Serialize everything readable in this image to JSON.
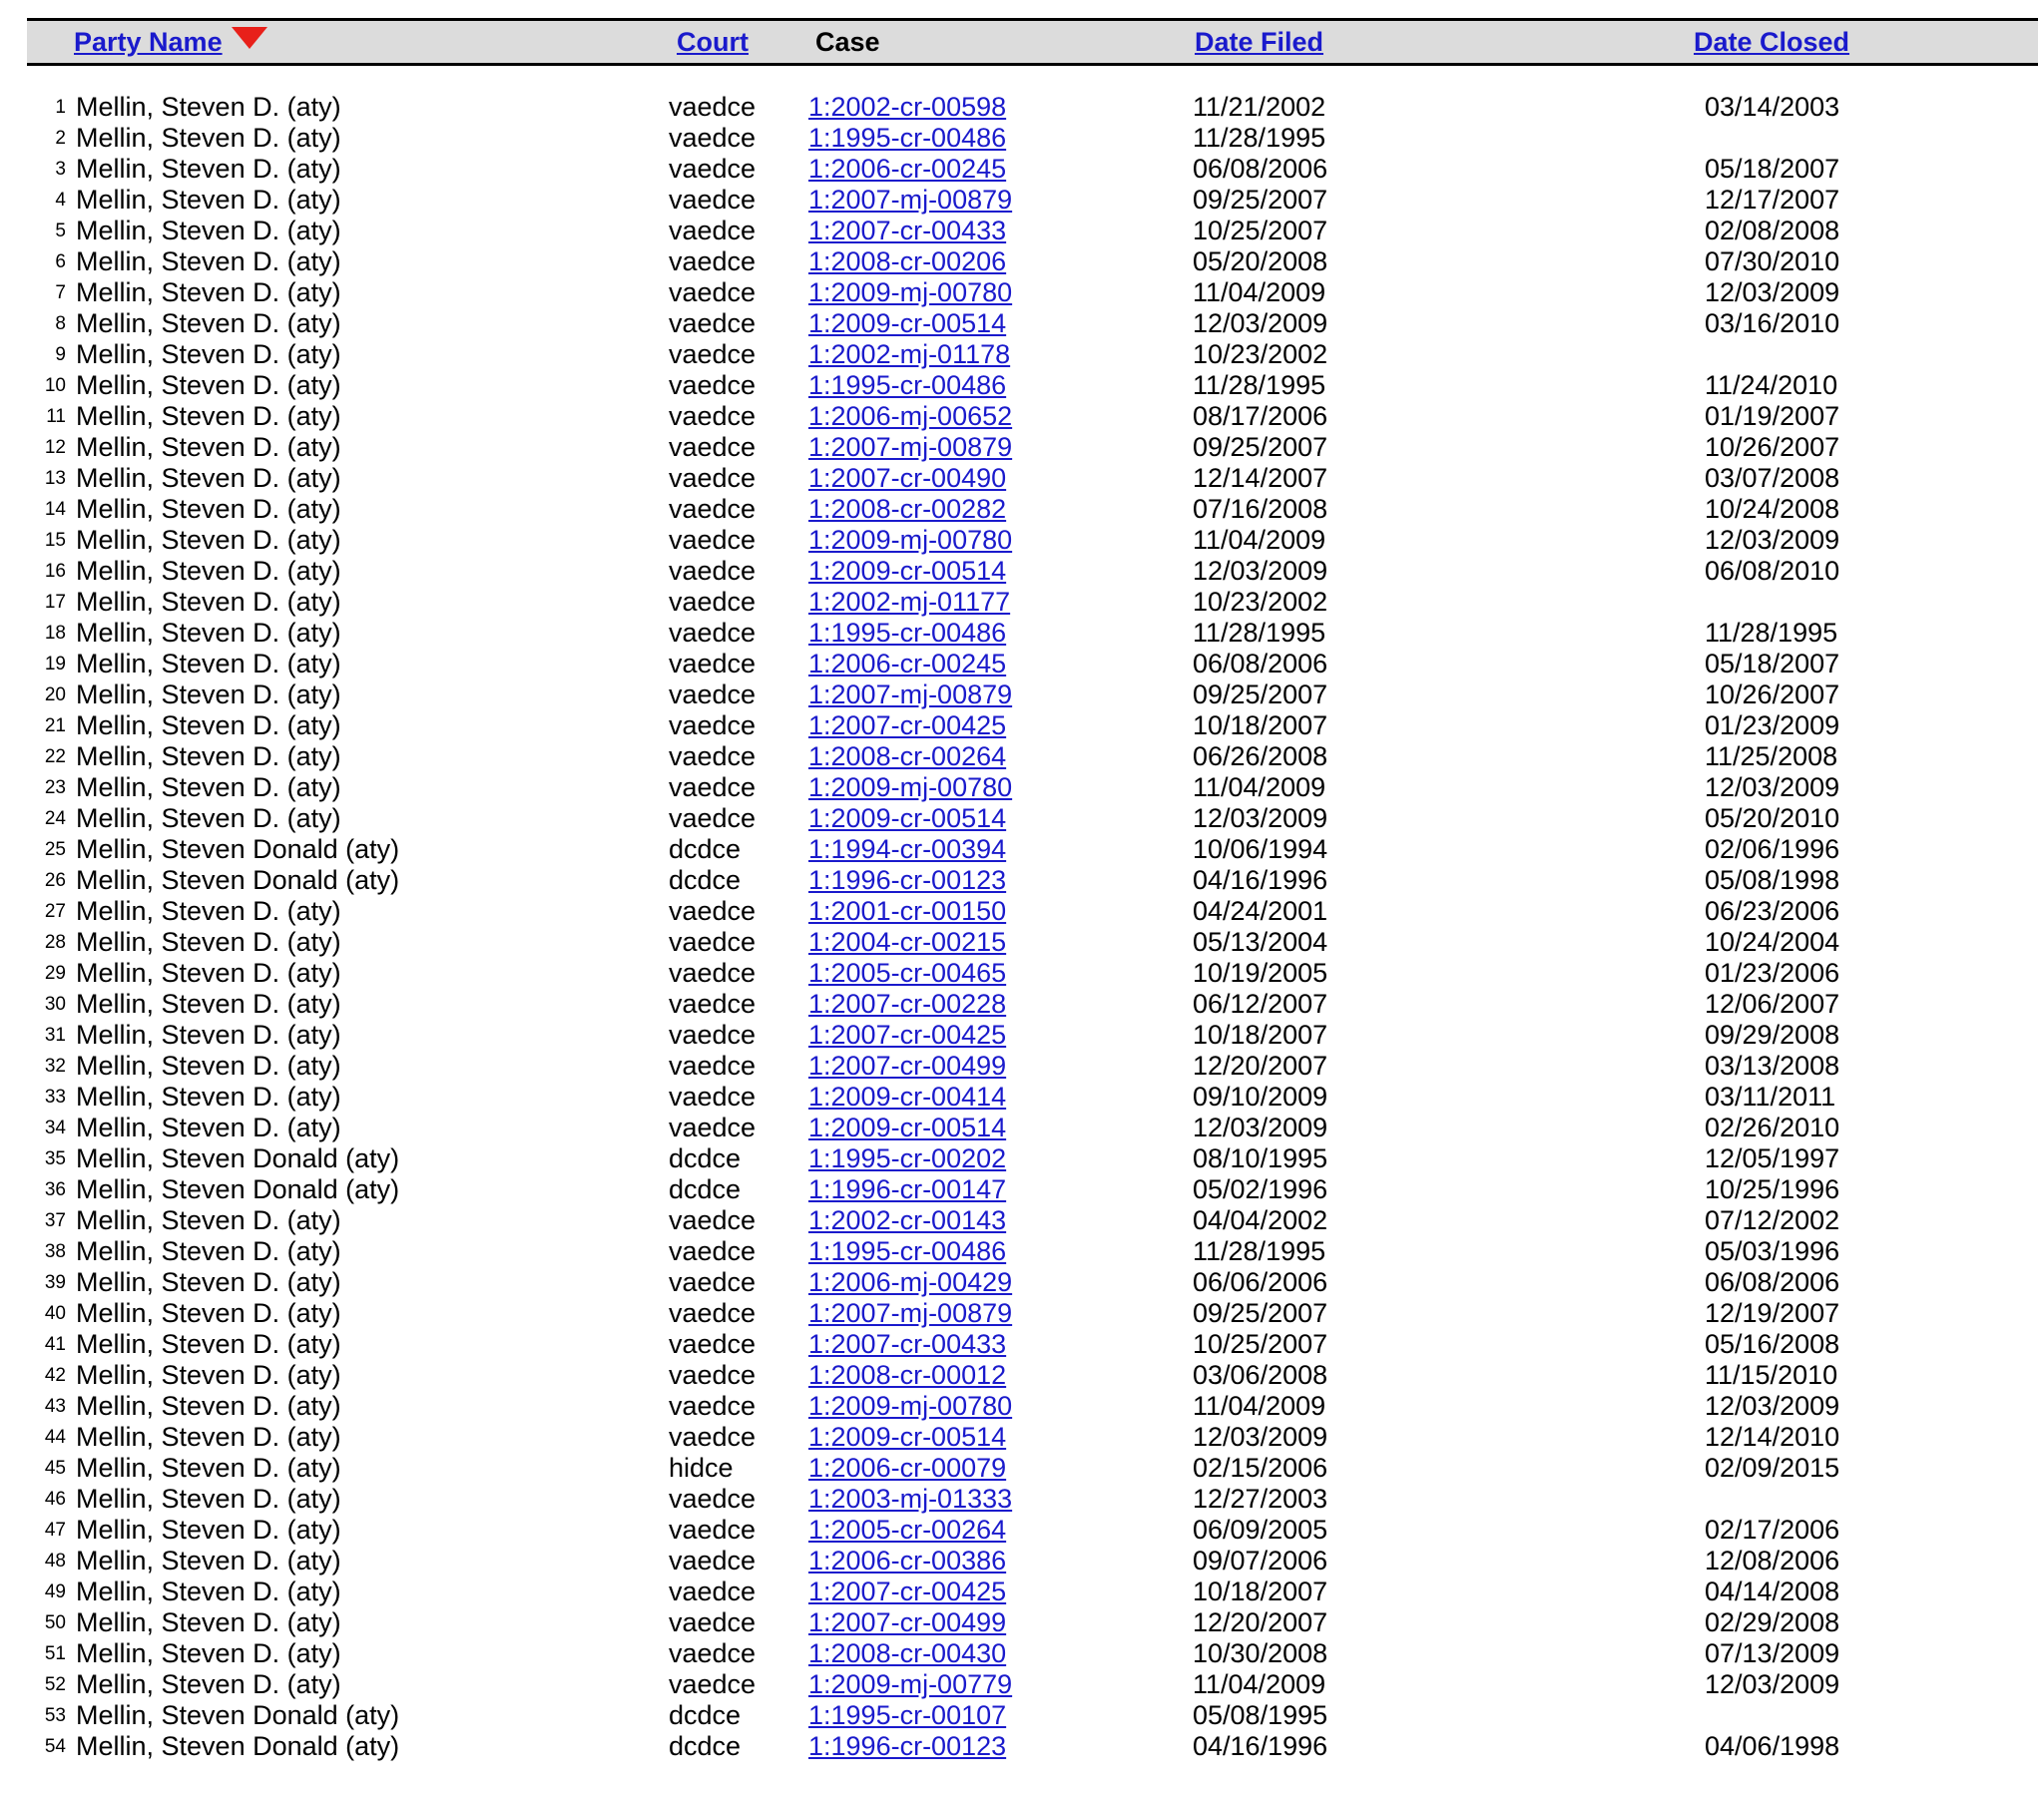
{
  "header": {
    "party_name": "Party Name",
    "court": "Court",
    "case": "Case",
    "date_filed": "Date Filed",
    "date_closed": "Date Closed",
    "sort_icon": "sort-descending-triangle",
    "sort_color": "#e8201a",
    "link_color": "#1a1acc",
    "header_bg": "#dcdcdc"
  },
  "rows": [
    {
      "num": "1",
      "name": "Mellin, Steven D. (aty)",
      "court": "vaedce",
      "case": "1:2002-cr-00598",
      "filed": "11/21/2002",
      "closed": "03/14/2003"
    },
    {
      "num": "2",
      "name": "Mellin, Steven D. (aty)",
      "court": "vaedce",
      "case": "1:1995-cr-00486",
      "filed": "11/28/1995",
      "closed": ""
    },
    {
      "num": "3",
      "name": "Mellin, Steven D. (aty)",
      "court": "vaedce",
      "case": "1:2006-cr-00245",
      "filed": "06/08/2006",
      "closed": "05/18/2007"
    },
    {
      "num": "4",
      "name": "Mellin, Steven D. (aty)",
      "court": "vaedce",
      "case": "1:2007-mj-00879",
      "filed": "09/25/2007",
      "closed": "12/17/2007"
    },
    {
      "num": "5",
      "name": "Mellin, Steven D. (aty)",
      "court": "vaedce",
      "case": "1:2007-cr-00433",
      "filed": "10/25/2007",
      "closed": "02/08/2008"
    },
    {
      "num": "6",
      "name": "Mellin, Steven D. (aty)",
      "court": "vaedce",
      "case": "1:2008-cr-00206",
      "filed": "05/20/2008",
      "closed": "07/30/2010"
    },
    {
      "num": "7",
      "name": "Mellin, Steven D. (aty)",
      "court": "vaedce",
      "case": "1:2009-mj-00780",
      "filed": "11/04/2009",
      "closed": "12/03/2009"
    },
    {
      "num": "8",
      "name": "Mellin, Steven D. (aty)",
      "court": "vaedce",
      "case": "1:2009-cr-00514",
      "filed": "12/03/2009",
      "closed": "03/16/2010"
    },
    {
      "num": "9",
      "name": "Mellin, Steven D. (aty)",
      "court": "vaedce",
      "case": "1:2002-mj-01178",
      "filed": "10/23/2002",
      "closed": ""
    },
    {
      "num": "10",
      "name": "Mellin, Steven D. (aty)",
      "court": "vaedce",
      "case": "1:1995-cr-00486",
      "filed": "11/28/1995",
      "closed": "11/24/2010"
    },
    {
      "num": "11",
      "name": "Mellin, Steven D. (aty)",
      "court": "vaedce",
      "case": "1:2006-mj-00652",
      "filed": "08/17/2006",
      "closed": "01/19/2007"
    },
    {
      "num": "12",
      "name": "Mellin, Steven D. (aty)",
      "court": "vaedce",
      "case": "1:2007-mj-00879",
      "filed": "09/25/2007",
      "closed": "10/26/2007"
    },
    {
      "num": "13",
      "name": "Mellin, Steven D. (aty)",
      "court": "vaedce",
      "case": "1:2007-cr-00490",
      "filed": "12/14/2007",
      "closed": "03/07/2008"
    },
    {
      "num": "14",
      "name": "Mellin, Steven D. (aty)",
      "court": "vaedce",
      "case": "1:2008-cr-00282",
      "filed": "07/16/2008",
      "closed": "10/24/2008"
    },
    {
      "num": "15",
      "name": "Mellin, Steven D. (aty)",
      "court": "vaedce",
      "case": "1:2009-mj-00780",
      "filed": "11/04/2009",
      "closed": "12/03/2009"
    },
    {
      "num": "16",
      "name": "Mellin, Steven D. (aty)",
      "court": "vaedce",
      "case": "1:2009-cr-00514",
      "filed": "12/03/2009",
      "closed": "06/08/2010"
    },
    {
      "num": "17",
      "name": "Mellin, Steven D. (aty)",
      "court": "vaedce",
      "case": "1:2002-mj-01177",
      "filed": "10/23/2002",
      "closed": ""
    },
    {
      "num": "18",
      "name": "Mellin, Steven D. (aty)",
      "court": "vaedce",
      "case": "1:1995-cr-00486",
      "filed": "11/28/1995",
      "closed": "11/28/1995"
    },
    {
      "num": "19",
      "name": "Mellin, Steven D. (aty)",
      "court": "vaedce",
      "case": "1:2006-cr-00245",
      "filed": "06/08/2006",
      "closed": "05/18/2007"
    },
    {
      "num": "20",
      "name": "Mellin, Steven D. (aty)",
      "court": "vaedce",
      "case": "1:2007-mj-00879",
      "filed": "09/25/2007",
      "closed": "10/26/2007"
    },
    {
      "num": "21",
      "name": "Mellin, Steven D. (aty)",
      "court": "vaedce",
      "case": "1:2007-cr-00425",
      "filed": "10/18/2007",
      "closed": "01/23/2009"
    },
    {
      "num": "22",
      "name": "Mellin, Steven D. (aty)",
      "court": "vaedce",
      "case": "1:2008-cr-00264",
      "filed": "06/26/2008",
      "closed": "11/25/2008"
    },
    {
      "num": "23",
      "name": "Mellin, Steven D. (aty)",
      "court": "vaedce",
      "case": "1:2009-mj-00780",
      "filed": "11/04/2009",
      "closed": "12/03/2009"
    },
    {
      "num": "24",
      "name": "Mellin, Steven D. (aty)",
      "court": "vaedce",
      "case": "1:2009-cr-00514",
      "filed": "12/03/2009",
      "closed": "05/20/2010"
    },
    {
      "num": "25",
      "name": "Mellin, Steven Donald (aty)",
      "court": "dcdce",
      "case": "1:1994-cr-00394",
      "filed": "10/06/1994",
      "closed": "02/06/1996"
    },
    {
      "num": "26",
      "name": "Mellin, Steven Donald (aty)",
      "court": "dcdce",
      "case": "1:1996-cr-00123",
      "filed": "04/16/1996",
      "closed": "05/08/1998"
    },
    {
      "num": "27",
      "name": "Mellin, Steven D. (aty)",
      "court": "vaedce",
      "case": "1:2001-cr-00150",
      "filed": "04/24/2001",
      "closed": "06/23/2006"
    },
    {
      "num": "28",
      "name": "Mellin, Steven D. (aty)",
      "court": "vaedce",
      "case": "1:2004-cr-00215",
      "filed": "05/13/2004",
      "closed": "10/24/2004"
    },
    {
      "num": "29",
      "name": "Mellin, Steven D. (aty)",
      "court": "vaedce",
      "case": "1:2005-cr-00465",
      "filed": "10/19/2005",
      "closed": "01/23/2006"
    },
    {
      "num": "30",
      "name": "Mellin, Steven D. (aty)",
      "court": "vaedce",
      "case": "1:2007-cr-00228",
      "filed": "06/12/2007",
      "closed": "12/06/2007"
    },
    {
      "num": "31",
      "name": "Mellin, Steven D. (aty)",
      "court": "vaedce",
      "case": "1:2007-cr-00425",
      "filed": "10/18/2007",
      "closed": "09/29/2008"
    },
    {
      "num": "32",
      "name": "Mellin, Steven D. (aty)",
      "court": "vaedce",
      "case": "1:2007-cr-00499",
      "filed": "12/20/2007",
      "closed": "03/13/2008"
    },
    {
      "num": "33",
      "name": "Mellin, Steven D. (aty)",
      "court": "vaedce",
      "case": "1:2009-cr-00414",
      "filed": "09/10/2009",
      "closed": "03/11/2011"
    },
    {
      "num": "34",
      "name": "Mellin, Steven D. (aty)",
      "court": "vaedce",
      "case": "1:2009-cr-00514",
      "filed": "12/03/2009",
      "closed": "02/26/2010"
    },
    {
      "num": "35",
      "name": "Mellin, Steven Donald (aty)",
      "court": "dcdce",
      "case": "1:1995-cr-00202",
      "filed": "08/10/1995",
      "closed": "12/05/1997"
    },
    {
      "num": "36",
      "name": "Mellin, Steven Donald (aty)",
      "court": "dcdce",
      "case": "1:1996-cr-00147",
      "filed": "05/02/1996",
      "closed": "10/25/1996"
    },
    {
      "num": "37",
      "name": "Mellin, Steven D. (aty)",
      "court": "vaedce",
      "case": "1:2002-cr-00143",
      "filed": "04/04/2002",
      "closed": "07/12/2002"
    },
    {
      "num": "38",
      "name": "Mellin, Steven D. (aty)",
      "court": "vaedce",
      "case": "1:1995-cr-00486",
      "filed": "11/28/1995",
      "closed": "05/03/1996"
    },
    {
      "num": "39",
      "name": "Mellin, Steven D. (aty)",
      "court": "vaedce",
      "case": "1:2006-mj-00429",
      "filed": "06/06/2006",
      "closed": "06/08/2006"
    },
    {
      "num": "40",
      "name": "Mellin, Steven D. (aty)",
      "court": "vaedce",
      "case": "1:2007-mj-00879",
      "filed": "09/25/2007",
      "closed": "12/19/2007"
    },
    {
      "num": "41",
      "name": "Mellin, Steven D. (aty)",
      "court": "vaedce",
      "case": "1:2007-cr-00433",
      "filed": "10/25/2007",
      "closed": "05/16/2008"
    },
    {
      "num": "42",
      "name": "Mellin, Steven D. (aty)",
      "court": "vaedce",
      "case": "1:2008-cr-00012",
      "filed": "03/06/2008",
      "closed": "11/15/2010"
    },
    {
      "num": "43",
      "name": "Mellin, Steven D. (aty)",
      "court": "vaedce",
      "case": "1:2009-mj-00780",
      "filed": "11/04/2009",
      "closed": "12/03/2009"
    },
    {
      "num": "44",
      "name": "Mellin, Steven D. (aty)",
      "court": "vaedce",
      "case": "1:2009-cr-00514",
      "filed": "12/03/2009",
      "closed": "12/14/2010"
    },
    {
      "num": "45",
      "name": "Mellin, Steven D. (aty)",
      "court": "hidce",
      "case": "1:2006-cr-00079",
      "filed": "02/15/2006",
      "closed": "02/09/2015"
    },
    {
      "num": "46",
      "name": "Mellin, Steven D. (aty)",
      "court": "vaedce",
      "case": "1:2003-mj-01333",
      "filed": "12/27/2003",
      "closed": ""
    },
    {
      "num": "47",
      "name": "Mellin, Steven D. (aty)",
      "court": "vaedce",
      "case": "1:2005-cr-00264",
      "filed": "06/09/2005",
      "closed": "02/17/2006"
    },
    {
      "num": "48",
      "name": "Mellin, Steven D. (aty)",
      "court": "vaedce",
      "case": "1:2006-cr-00386",
      "filed": "09/07/2006",
      "closed": "12/08/2006"
    },
    {
      "num": "49",
      "name": "Mellin, Steven D. (aty)",
      "court": "vaedce",
      "case": "1:2007-cr-00425",
      "filed": "10/18/2007",
      "closed": "04/14/2008"
    },
    {
      "num": "50",
      "name": "Mellin, Steven D. (aty)",
      "court": "vaedce",
      "case": "1:2007-cr-00499",
      "filed": "12/20/2007",
      "closed": "02/29/2008"
    },
    {
      "num": "51",
      "name": "Mellin, Steven D. (aty)",
      "court": "vaedce",
      "case": "1:2008-cr-00430",
      "filed": "10/30/2008",
      "closed": "07/13/2009"
    },
    {
      "num": "52",
      "name": "Mellin, Steven D. (aty)",
      "court": "vaedce",
      "case": "1:2009-mj-00779",
      "filed": "11/04/2009",
      "closed": "12/03/2009"
    },
    {
      "num": "53",
      "name": "Mellin, Steven Donald (aty)",
      "court": "dcdce",
      "case": "1:1995-cr-00107",
      "filed": "05/08/1995",
      "closed": ""
    },
    {
      "num": "54",
      "name": "Mellin, Steven Donald (aty)",
      "court": "dcdce",
      "case": "1:1996-cr-00123",
      "filed": "04/16/1996",
      "closed": "04/06/1998"
    }
  ]
}
